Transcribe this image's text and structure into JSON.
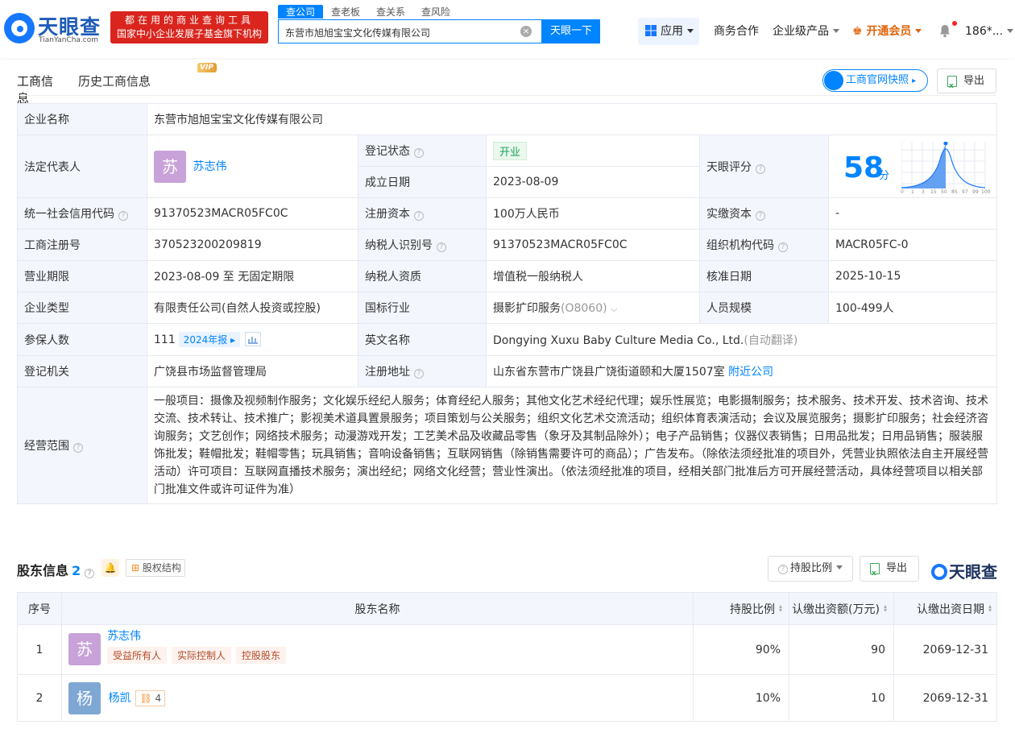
{
  "header": {
    "brand": "天眼查",
    "brand_sub": "TianYanCha.com",
    "slogan_line1": "都在用的商业查询工具",
    "slogan_line2": "国家中小企业发展子基金旗下机构",
    "search_tabs": [
      "查公司",
      "查老板",
      "查关系",
      "查风险"
    ],
    "search_value": "东营市旭旭宝宝文化传媒有限公司",
    "search_button": "天眼一下",
    "apps": "应用",
    "nav_biz": "商务合作",
    "nav_enterprise": "企业级产品",
    "nav_vip": "开通会员",
    "user": "186*..."
  },
  "tabs": {
    "basic": "工商信息",
    "history": "历史工商信息",
    "vip_badge": "VIP"
  },
  "actions": {
    "snapshot": "工商官网快照",
    "export": "导出"
  },
  "info": {
    "company_name_label": "企业名称",
    "company_name": "东营市旭旭宝宝文化传媒有限公司",
    "legal_rep_label": "法定代表人",
    "legal_rep": "苏志伟",
    "legal_rep_avatar": "苏",
    "status_label": "登记状态",
    "status": "开业",
    "founded_label": "成立日期",
    "founded": "2023-08-09",
    "score_label": "天眼评分",
    "score": "58",
    "score_unit": "分",
    "score_axis": [
      "0",
      "1",
      "3",
      "15",
      "50",
      "85",
      "97",
      "99",
      "100"
    ],
    "credit_code_label": "统一社会信用代码",
    "credit_code": "91370523MACR05FC0C",
    "reg_capital_label": "注册资本",
    "reg_capital": "100万人民币",
    "paid_capital_label": "实缴资本",
    "paid_capital": "-",
    "reg_no_label": "工商注册号",
    "reg_no": "370523200209819",
    "taxpayer_id_label": "纳税人识别号",
    "taxpayer_id": "91370523MACR05FC0C",
    "org_code_label": "组织机构代码",
    "org_code": "MACR05FC-0",
    "term_label": "营业期限",
    "term": "2023-08-09 至 无固定期限",
    "taxpayer_type_label": "纳税人资质",
    "taxpayer_type": "增值税一般纳税人",
    "approve_date_label": "核准日期",
    "approve_date": "2025-10-15",
    "type_label": "企业类型",
    "type": "有限责任公司(自然人投资或控股)",
    "industry_label": "国标行业",
    "industry": "摄影扩印服务",
    "industry_code": "(O8060)",
    "staff_label": "人员规模",
    "staff": "100-499人",
    "insured_label": "参保人数",
    "insured": "111",
    "insured_report": "2024年报",
    "en_name_label": "英文名称",
    "en_name": "Dongying Xuxu Baby Culture Media Co., Ltd.",
    "en_auto": "(自动翻译)",
    "authority_label": "登记机关",
    "authority": "广饶县市场监督管理局",
    "address_label": "注册地址",
    "address": "山东省东营市广饶县广饶街道颐和大厦1507室",
    "nearby": "附近公司",
    "scope_label": "经营范围",
    "scope": "一般项目：摄像及视频制作服务；文化娱乐经纪人服务；体育经纪人服务；其他文化艺术经纪代理；娱乐性展览；电影摄制服务；技术服务、技术开发、技术咨询、技术交流、技术转让、技术推广；影视美术道具置景服务；项目策划与公关服务；组织文化艺术交流活动；组织体育表演活动；会议及展览服务；摄影扩印服务；社会经济咨询服务；文艺创作；网络技术服务；动漫游戏开发；工艺美术品及收藏品零售（象牙及其制品除外）；电子产品销售；仪器仪表销售；日用品批发；日用品销售；服装服饰批发；鞋帽批发；鞋帽零售；玩具销售；音响设备销售；互联网销售（除销售需要许可的商品）；广告发布。（除依法须经批准的项目外，凭营业执照依法自主开展经营活动）许可项目：互联网直播技术服务；演出经纪；网络文化经营；营业性演出。（依法须经批准的项目，经相关部门批准后方可开展经营活动，具体经营项目以相关部门批准文件或许可证件为准）"
  },
  "shareholders": {
    "title": "股东信息",
    "count": "2",
    "structure": "股权结构",
    "ratio_btn": "持股比例",
    "export": "导出",
    "watermark": "天眼查",
    "columns": [
      "序号",
      "股东名称",
      "持股比例",
      "认缴出资额(万元)",
      "认缴出资日期"
    ],
    "rows": [
      {
        "no": "1",
        "avatar": "苏",
        "name": "苏志伟",
        "tags": [
          "受益所有人",
          "实际控制人",
          "控股股东"
        ],
        "ratio": "90%",
        "amount": "90",
        "date": "2069-12-31"
      },
      {
        "no": "2",
        "avatar": "杨",
        "name": "杨凯",
        "equity": "4",
        "ratio": "10%",
        "amount": "10",
        "date": "2069-12-31"
      }
    ]
  }
}
